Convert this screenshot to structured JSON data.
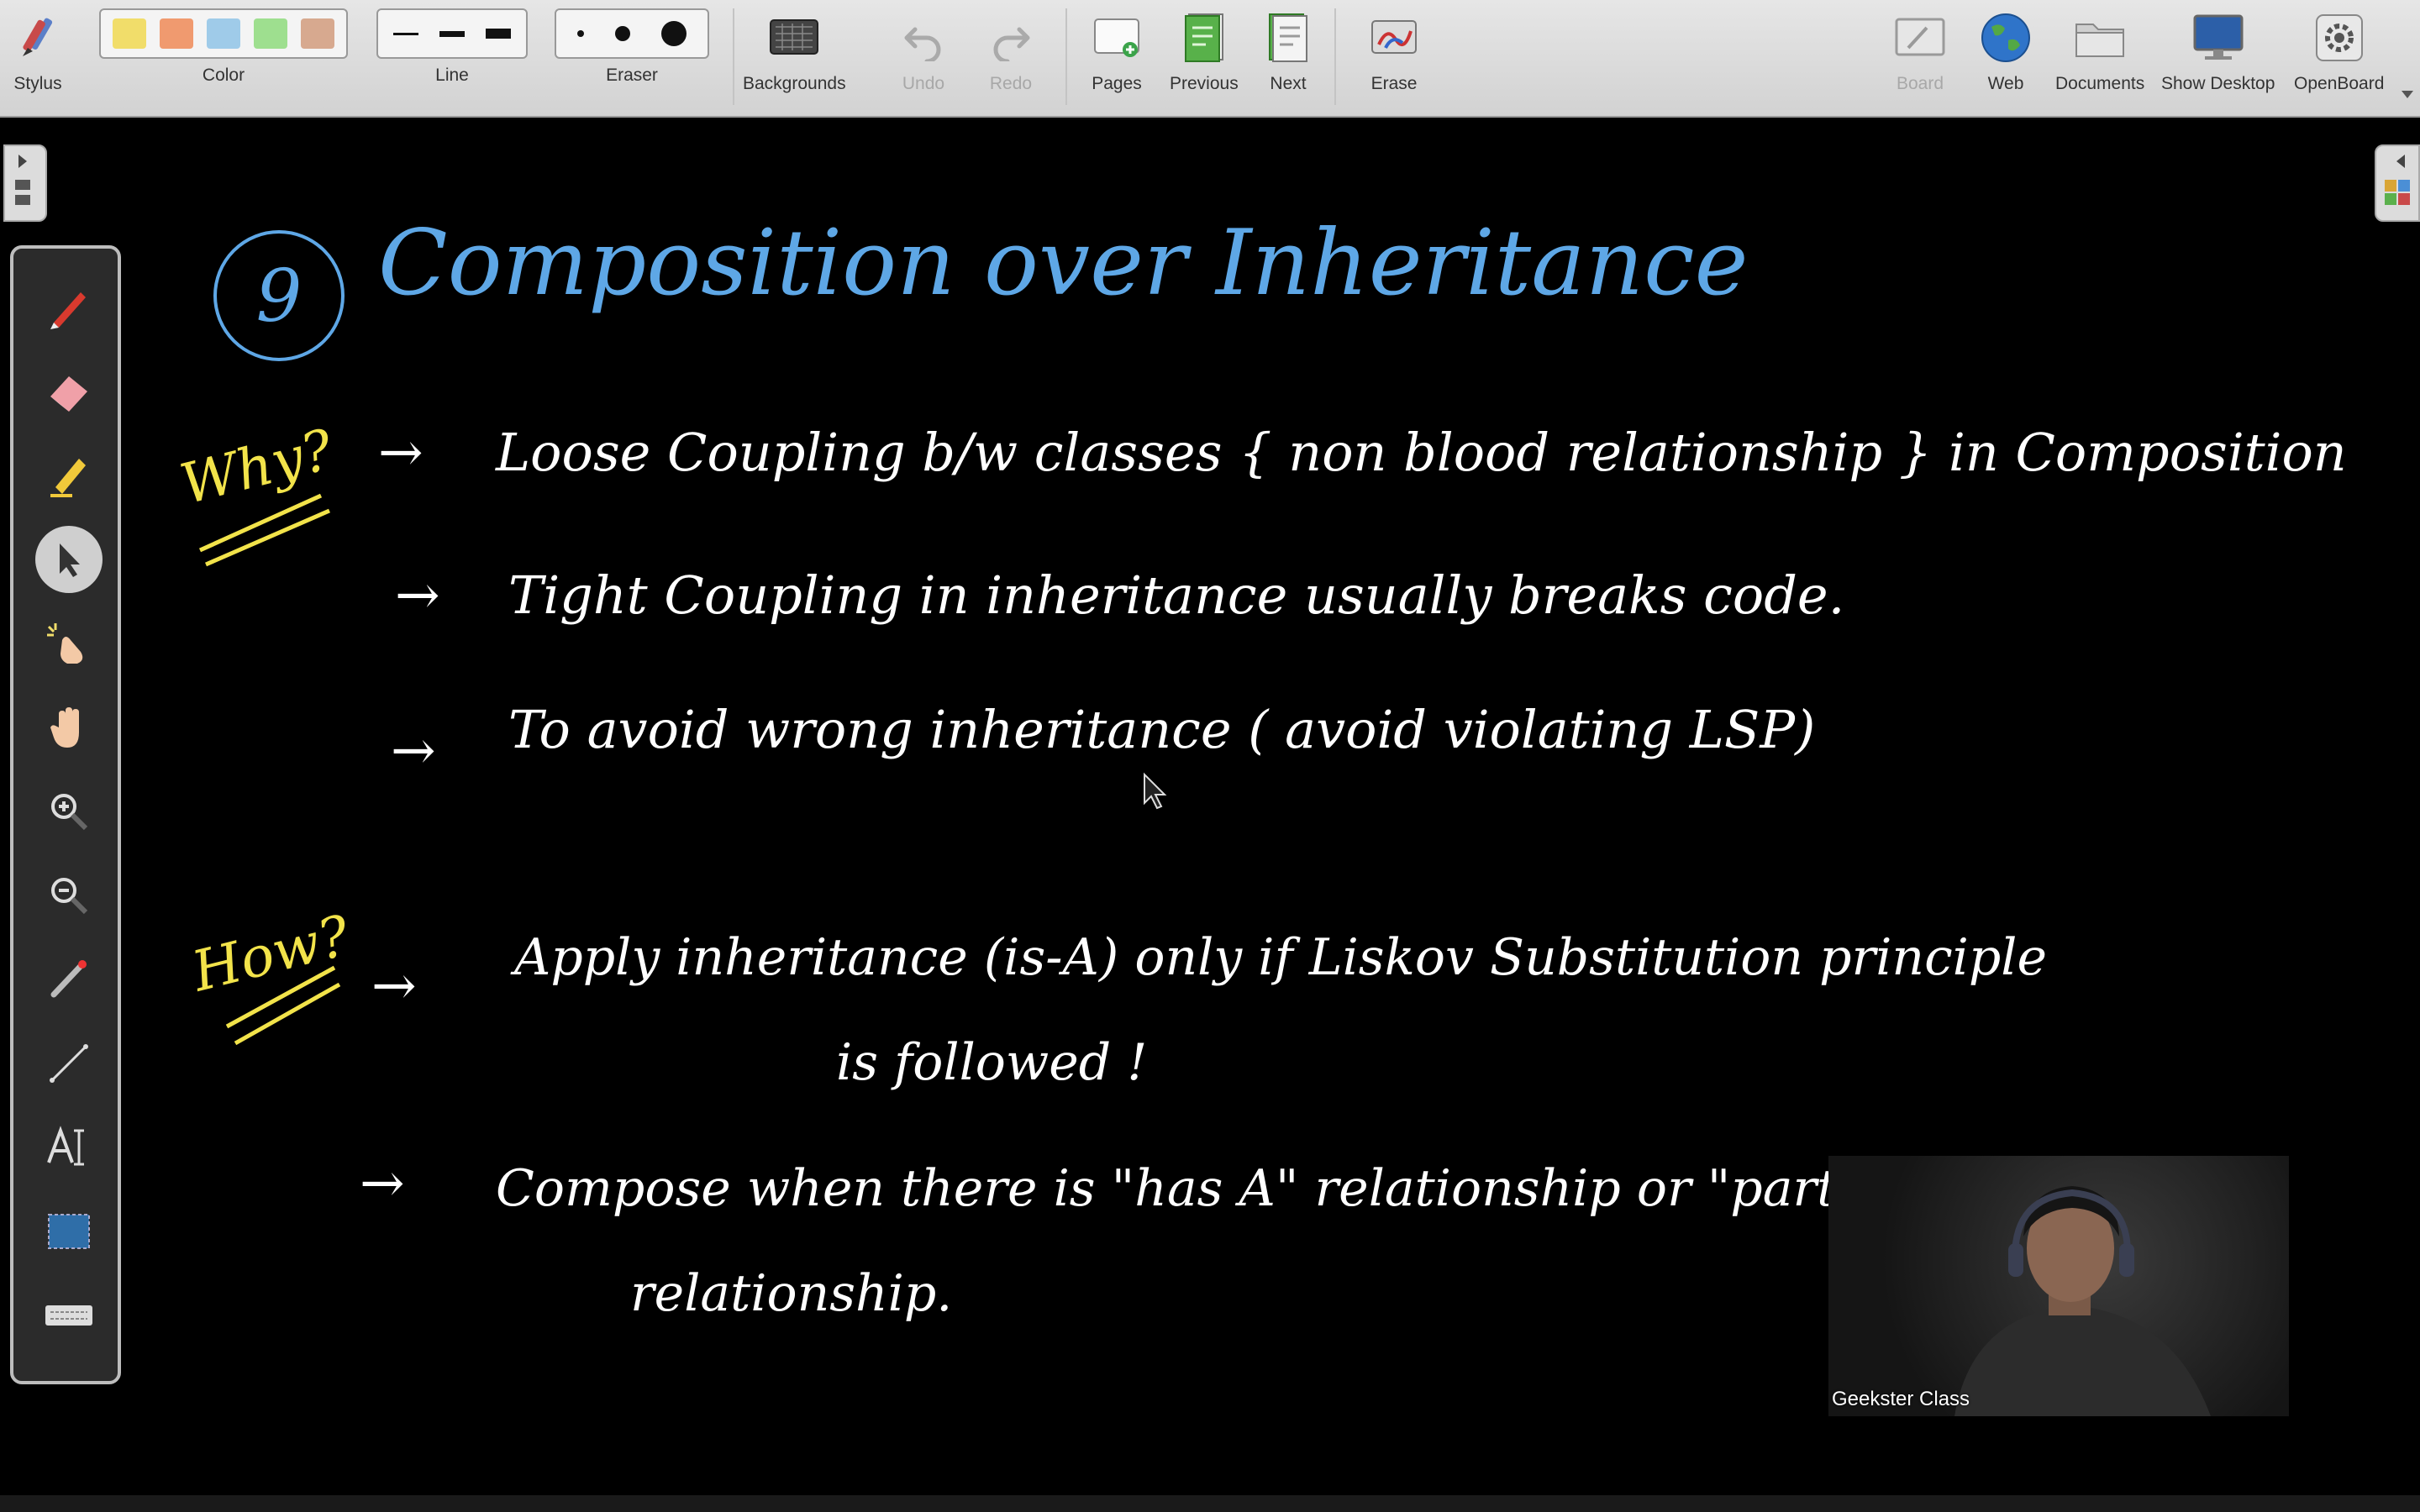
{
  "toolbar": {
    "stylus": "Stylus",
    "color": "Color",
    "line": "Line",
    "eraser": "Eraser",
    "backgrounds": "Backgrounds",
    "undo": "Undo",
    "redo": "Redo",
    "pages": "Pages",
    "previous": "Previous",
    "next": "Next",
    "erase": "Erase",
    "board": "Board",
    "web": "Web",
    "documents": "Documents",
    "show_desktop": "Show Desktop",
    "openboard": "OpenBoard",
    "color_swatches": [
      "#f1dd6a",
      "#f09a6f",
      "#9fcbe9",
      "#9edf8f",
      "#d7a98f"
    ]
  },
  "palette": {
    "icons": [
      "pen-icon",
      "eraser-icon",
      "highlighter-icon",
      "selector-icon",
      "interactor-icon",
      "hand-icon",
      "zoom-in-icon",
      "zoom-out-icon",
      "laser-pointer-icon",
      "line-icon",
      "text-icon",
      "capture-icon",
      "keyboard-icon"
    ]
  },
  "board": {
    "title_number": "9",
    "title": "Composition over Inheritance",
    "why_label": "Why?",
    "why_points": [
      "Loose Coupling b/w classes { non blood relationship } in Composition",
      "Tight Coupling in inheritance usually breaks code.",
      "To avoid wrong inheritance ( avoid violating LSP)"
    ],
    "how_label": "How?",
    "how_point_1_line_1": "Apply inheritance (is-A) only if Liskov Substitution principle",
    "how_point_1_line_2": "is followed !",
    "how_point_2_line_1": "Compose when there is \"has A\" relationship or \"part of\"",
    "how_point_2_line_2": "relationship.",
    "arrow": "→",
    "ink_colors": {
      "title": "#5ea7e6",
      "labels": "#f2e34a",
      "text": "#ffffff"
    }
  },
  "webcam": {
    "label": "Geekster Class"
  }
}
